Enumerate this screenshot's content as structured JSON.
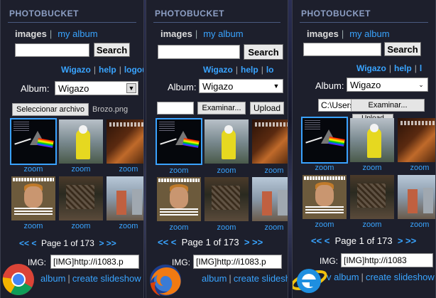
{
  "panel": {
    "title": "PHOTOBUCKET",
    "tab_images": "images",
    "tab_separator": "|",
    "tab_album": "my album",
    "search_label": "Search",
    "user": "Wigazo",
    "help": "help",
    "logout": "logout",
    "link_separator": "|",
    "album_label": "Album:",
    "album_value": "Wigazo",
    "zoom": "zoom",
    "pager_prev": "<<  <",
    "pager_next": ">  >>",
    "pager_text": "Page 1 of 173",
    "img_label": "IMG:",
    "img_value": "[IMG]http://i1083.p",
    "album_link": "album",
    "slideshow_link": "create slideshow"
  },
  "chrome": {
    "logout_clipped": "logou",
    "file_button": "Seleccionar archivo",
    "file_name": "Brozo.png"
  },
  "firefox": {
    "logout_clipped": "lo",
    "browse_button": "Examinar...",
    "upload_button": "Upload"
  },
  "ie": {
    "logout_clipped": "l",
    "path_value": "C:\\Users\\A",
    "browse_button": "Examinar...",
    "upload_ghost": "Upload",
    "img_value": "[IMG]http://i1083",
    "album_partial": "album",
    "bottom_prefix": "v"
  },
  "colors": {
    "link": "#39a4ff",
    "panel_bg": "#1d1f2c",
    "title": "#8d9fc4",
    "selected_outline": "#3aa2ff"
  },
  "icons": {
    "chrome": "chrome-logo-icon",
    "firefox": "firefox-logo-icon",
    "ie": "internet-explorer-logo-icon",
    "select_arrow": "chevron-down-icon"
  }
}
